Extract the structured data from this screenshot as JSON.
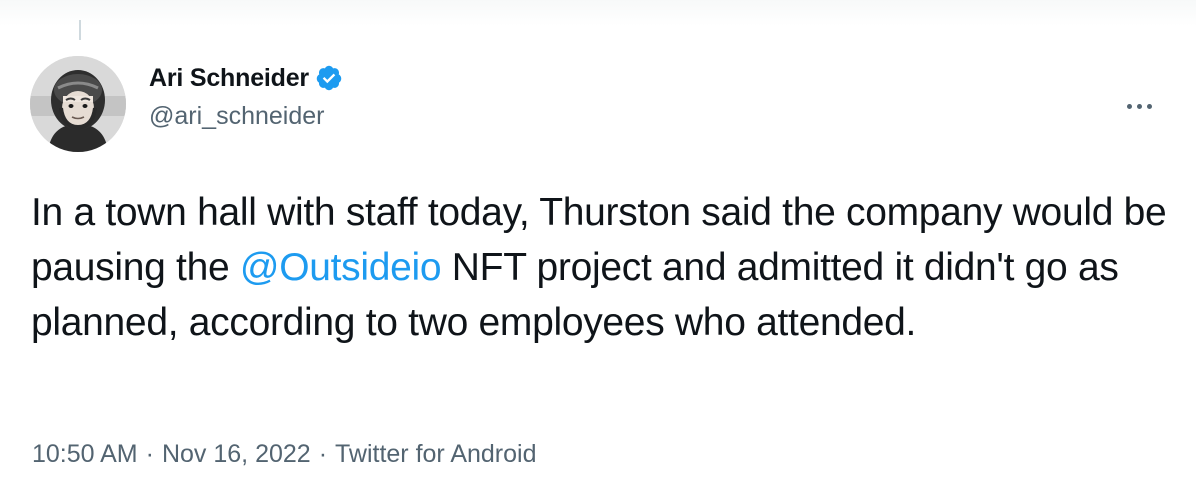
{
  "author": {
    "display_name": "Ari Schneider",
    "handle": "@ari_schneider",
    "verified": true
  },
  "tweet": {
    "text_before": "In a town hall with staff today, Thurston said the company would be pausing the ",
    "mention": "@Outsideio",
    "text_after": " NFT project and admitted it didn't go as planned, according to two employees who attended."
  },
  "meta": {
    "time": "10:50 AM",
    "separator": "·",
    "date": "Nov 16, 2022",
    "source": "Twitter for Android"
  },
  "icons": {
    "verified": "verified-badge-icon",
    "more": "more-options-icon"
  },
  "colors": {
    "accent": "#1d9bf0",
    "secondary_text": "#536471",
    "primary_text": "#0f1419"
  }
}
